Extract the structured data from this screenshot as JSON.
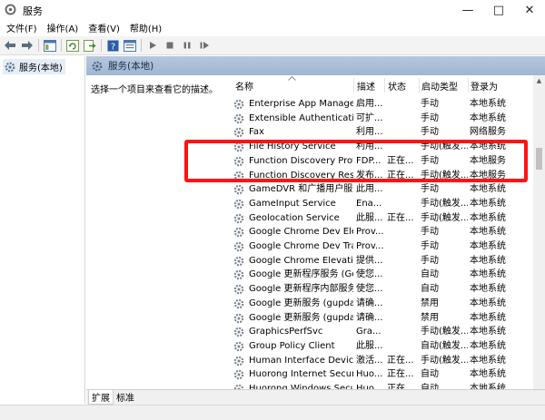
{
  "window": {
    "title": "服务",
    "minimize": "—",
    "maximize": "□",
    "close": "✕"
  },
  "menu": [
    "文件(F)",
    "操作(A)",
    "查看(V)",
    "帮助(H)"
  ],
  "toolbar_icons": [
    "back-arrow-icon",
    "forward-arrow-icon",
    "console-tree-icon",
    "refresh-icon",
    "export-list-icon",
    "help-icon",
    "properties-icon",
    "play-icon",
    "stop-icon",
    "pause-icon",
    "restart-icon"
  ],
  "tree": {
    "label": "服务(本地)"
  },
  "pane": {
    "header": "服务(本地)",
    "description": "选择一个项目来查看它的描述。"
  },
  "columns": [
    "名称",
    "描述",
    "状态",
    "启动类型",
    "登录为"
  ],
  "services": [
    {
      "name": "Enterprise App Manage...",
      "desc": "启用...",
      "status": "",
      "startup": "手动",
      "logon": "本地系统"
    },
    {
      "name": "Extensible Authentication...",
      "desc": "可扩...",
      "status": "",
      "startup": "手动",
      "logon": "本地系统"
    },
    {
      "name": "Fax",
      "desc": "利用...",
      "status": "",
      "startup": "手动",
      "logon": "网络服务"
    },
    {
      "name": "File History Service",
      "desc": "利用...",
      "status": "",
      "startup": "手动(触发...",
      "logon": "本地系统"
    },
    {
      "name": "Function Discovery Provi...",
      "desc": "FDP...",
      "status": "正在...",
      "startup": "手动",
      "logon": "本地服务"
    },
    {
      "name": "Function Discovery Reso...",
      "desc": "发布...",
      "status": "正在...",
      "startup": "手动(触发...",
      "logon": "本地服务"
    },
    {
      "name": "GameDVR 和广播用户服务...",
      "desc": "此用...",
      "status": "",
      "startup": "手动",
      "logon": "本地系统"
    },
    {
      "name": "GameInput Service",
      "desc": "Ena...",
      "status": "",
      "startup": "手动(触发...",
      "logon": "本地系统"
    },
    {
      "name": "Geolocation Service",
      "desc": "此服...",
      "status": "正在...",
      "startup": "手动(触发...",
      "logon": "本地系统"
    },
    {
      "name": "Google Chrome Dev Elev...",
      "desc": "Prov...",
      "status": "",
      "startup": "手动",
      "logon": "本地系统"
    },
    {
      "name": "Google Chrome Dev Tra...",
      "desc": "Prov...",
      "status": "",
      "startup": "手动",
      "logon": "本地系统"
    },
    {
      "name": "Google Chrome Elevatio...",
      "desc": "提供...",
      "status": "",
      "startup": "手动",
      "logon": "本地系统"
    },
    {
      "name": "Google 更新程序服务 (Go...",
      "desc": "使您...",
      "status": "",
      "startup": "自动",
      "logon": "本地系统"
    },
    {
      "name": "Google 更新程序内部服务...",
      "desc": "使您...",
      "status": "",
      "startup": "自动",
      "logon": "本地系统"
    },
    {
      "name": "Google 更新服务 (gupdate)",
      "desc": "请确...",
      "status": "",
      "startup": "禁用",
      "logon": "本地系统"
    },
    {
      "name": "Google 更新服务 (gupdat...",
      "desc": "请确...",
      "status": "",
      "startup": "禁用",
      "logon": "本地系统"
    },
    {
      "name": "GraphicsPerfSvc",
      "desc": "Gra...",
      "status": "",
      "startup": "手动(触发...",
      "logon": "本地系统"
    },
    {
      "name": "Group Policy Client",
      "desc": "此服...",
      "status": "",
      "startup": "自动(触发...",
      "logon": "本地系统"
    },
    {
      "name": "Human Interface Device ...",
      "desc": "激活...",
      "status": "正在...",
      "startup": "手动(触发...",
      "logon": "本地系统"
    },
    {
      "name": "Huorong Internet Securit...",
      "desc": "Huo...",
      "status": "正在...",
      "startup": "自动",
      "logon": "本地系统"
    },
    {
      "name": "Huorong Windows Secur...",
      "desc": "Huo...",
      "status": "正在...",
      "startup": "自动",
      "logon": "本地系统"
    }
  ],
  "tabs": [
    "扩展",
    "标准"
  ],
  "colors": {
    "highlight": "#ff1313",
    "header_gradient_top": "#b5c7dd",
    "header_gradient_bottom": "#9fb6d2"
  }
}
